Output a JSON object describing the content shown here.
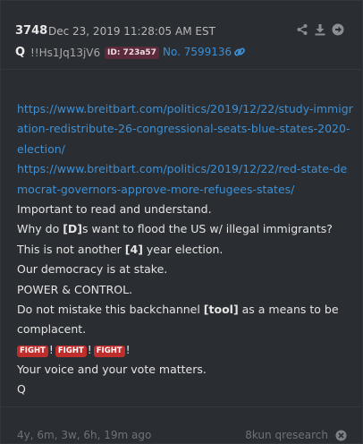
{
  "header": {
    "post_number": "3748",
    "date": "Dec 23, 2019 11:28:05 AM EST",
    "name": "Q",
    "tripcode": "!!Hs1Jq13jV6",
    "id_badge": "ID: 723a57",
    "post_no": "No. 7599136",
    "icons": [
      "share-icon",
      "download-icon",
      "next-arrow-icon",
      "link-icon"
    ]
  },
  "body": {
    "links": [
      "https://www.breitbart.com/politics/2019/12/22/study-immigration-redistribute-26-congressional-seats-blue-states-2020-election/",
      "https://www.breitbart.com/politics/2019/12/22/red-state-democrat-governors-approve-more-refugees-states/"
    ],
    "line_1": "Important to read and understand.",
    "line_2_pre": "Why do ",
    "line_2_bold": "[D]",
    "line_2_post": "s want to flood the US w/ illegal immigrants?",
    "line_3_pre": "This is not another ",
    "line_3_bold": "[4]",
    "line_3_post": " year election.",
    "line_4": "Our democracy is at stake.",
    "line_5": "POWER & CONTROL.",
    "line_6_pre": "Do not mistake this backchannel ",
    "line_6_bold": "[tool]",
    "line_6_post": " as a means to be complacent.",
    "fight_labels": [
      "FIGHT",
      "FIGHT",
      "FIGHT"
    ],
    "fight_sep": "!",
    "line_7": "Your voice and your vote matters.",
    "signature": "Q"
  },
  "footer": {
    "age": "4y, 6m, 3w, 6h, 19m ago",
    "source": "8kun qresearch"
  },
  "colors": {
    "background": "#2a2d31",
    "link": "#3e90d4",
    "id_badge": "#5b2b3c",
    "fight_badge": "#c02d2d",
    "muted": "#6d7378"
  }
}
